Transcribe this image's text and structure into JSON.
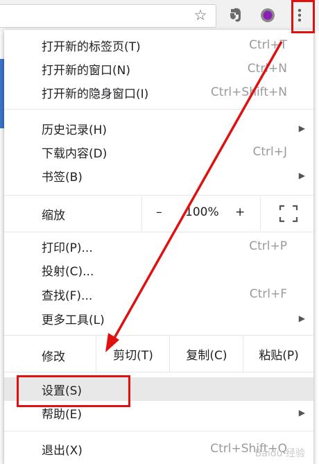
{
  "menu": {
    "group1": [
      {
        "label": "打开新的标签页(T)",
        "shortcut": "Ctrl+T"
      },
      {
        "label": "打开新的窗口(N)",
        "shortcut": "Ctrl+N"
      },
      {
        "label": "打开新的隐身窗口(I)",
        "shortcut": "Ctrl+Shift+N"
      }
    ],
    "group2": [
      {
        "label": "历史记录(H)",
        "has_submenu": true
      },
      {
        "label": "下载内容(D)",
        "shortcut": "Ctrl+J"
      },
      {
        "label": "书签(B)",
        "has_submenu": true
      }
    ],
    "zoom": {
      "label": "缩放",
      "minus": "–",
      "level": "100%",
      "plus": "+"
    },
    "group3": [
      {
        "label": "打印(P)...",
        "shortcut": "Ctrl+P"
      },
      {
        "label": "投射(C)..."
      },
      {
        "label": "查找(F)...",
        "shortcut": "Ctrl+F"
      },
      {
        "label": "更多工具(L)",
        "has_submenu": true
      }
    ],
    "edit": {
      "label": "修改",
      "cut": "剪切(T)",
      "copy": "复制(C)",
      "paste": "粘贴(P)"
    },
    "group4": [
      {
        "label": "设置(S)",
        "highlighted": true
      },
      {
        "label": "帮助(E)",
        "has_submenu": true
      }
    ],
    "exit": {
      "label": "退出(X)",
      "shortcut": "Ctrl+Shift+Q"
    }
  },
  "toolbar": {
    "icons": [
      "bookmark-star-icon",
      "evernote-icon",
      "extension-purple-circle-icon",
      "chrome-menu-icon"
    ]
  },
  "annotation": {
    "color": "#e01010"
  },
  "watermark": "Baidu 经验"
}
